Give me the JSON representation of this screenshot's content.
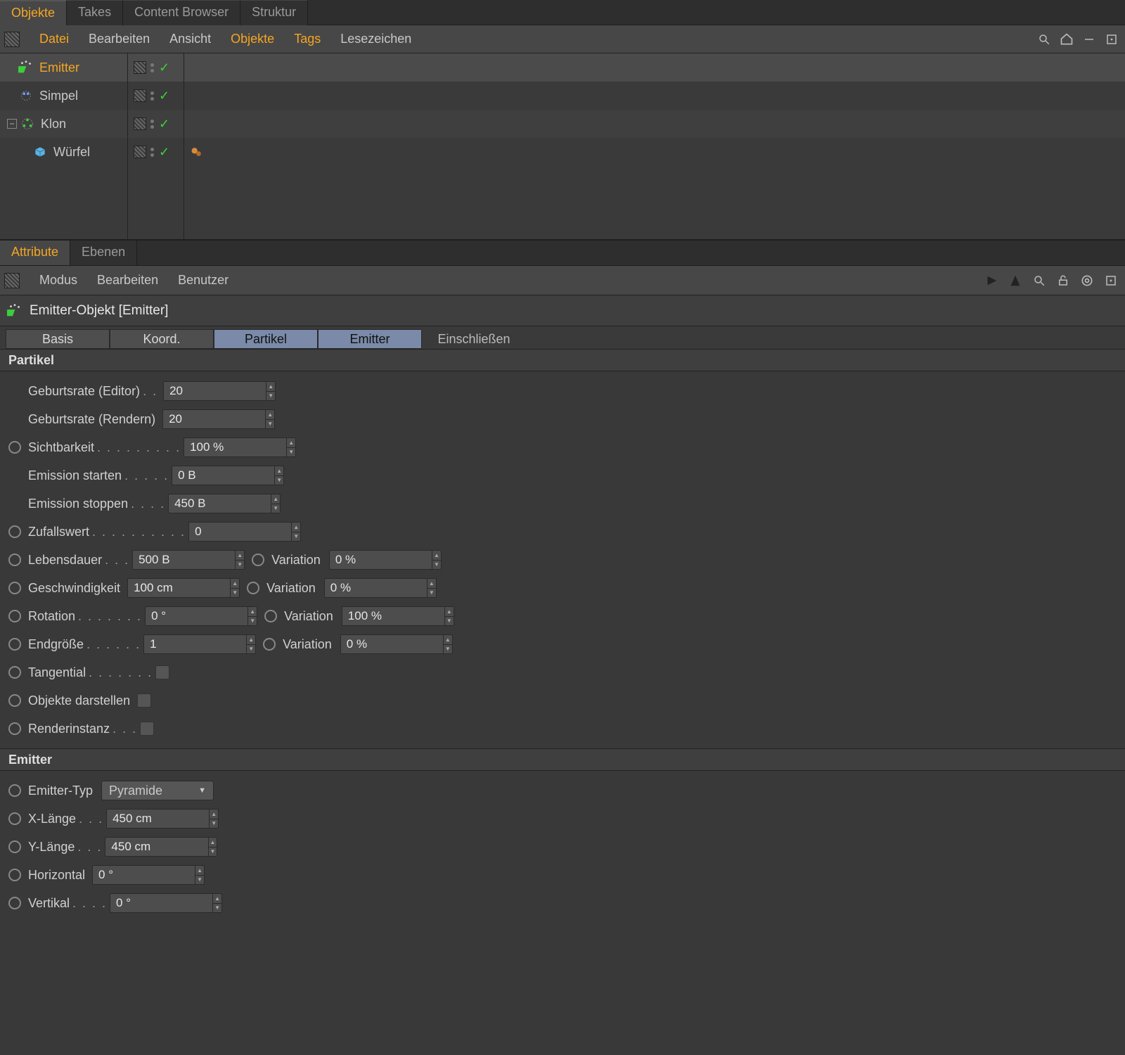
{
  "topTabs": {
    "t0": "Objekte",
    "t1": "Takes",
    "t2": "Content Browser",
    "t3": "Struktur"
  },
  "menubar": {
    "m0": "Datei",
    "m1": "Bearbeiten",
    "m2": "Ansicht",
    "m3": "Objekte",
    "m4": "Tags",
    "m5": "Lesezeichen"
  },
  "tree": {
    "r0": "Emitter",
    "r1": "Simpel",
    "r2": "Klon",
    "r3": "Würfel"
  },
  "panelTabs": {
    "p0": "Attribute",
    "p1": "Ebenen"
  },
  "attrMenu": {
    "a0": "Modus",
    "a1": "Bearbeiten",
    "a2": "Benutzer"
  },
  "objTitle": "Emitter-Objekt [Emitter]",
  "subtabs": {
    "s0": "Basis",
    "s1": "Koord.",
    "s2": "Partikel",
    "s3": "Emitter",
    "s4": "Einschließen"
  },
  "sections": {
    "partikel": "Partikel",
    "emitter": "Emitter"
  },
  "props": {
    "birthEditor": {
      "label": "Geburtsrate (Editor)",
      "value": "20"
    },
    "birthRender": {
      "label": "Geburtsrate (Rendern)",
      "value": "20"
    },
    "visibility": {
      "label": "Sichtbarkeit",
      "value": "100 %"
    },
    "emitStart": {
      "label": "Emission starten",
      "value": "0 B"
    },
    "emitStop": {
      "label": "Emission stoppen",
      "value": "450 B"
    },
    "seed": {
      "label": "Zufallswert",
      "value": "0"
    },
    "lifetime": {
      "label": "Lebensdauer",
      "value": "500 B"
    },
    "speed": {
      "label": "Geschwindigkeit",
      "value": "100 cm"
    },
    "rotation": {
      "label": "Rotation",
      "value": "0 °"
    },
    "endsize": {
      "label": "Endgröße",
      "value": "1"
    },
    "varLabel": "Variation",
    "varLifetime": "0 %",
    "varSpeed": "0 %",
    "varRotation": "100 %",
    "varEndsize": "0 %",
    "tangential": "Tangential",
    "showObjects": "Objekte darstellen",
    "renderInst": "Renderinstanz",
    "emitterType": {
      "label": "Emitter-Typ",
      "value": "Pyramide"
    },
    "xlen": {
      "label": "X-Länge",
      "value": "450 cm"
    },
    "ylen": {
      "label": "Y-Länge",
      "value": "450 cm"
    },
    "horiz": {
      "label": "Horizontal",
      "value": "0 °"
    },
    "vert": {
      "label": "Vertikal",
      "value": "0 °"
    }
  }
}
